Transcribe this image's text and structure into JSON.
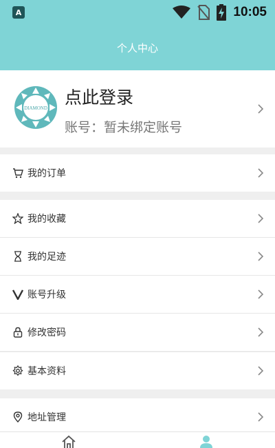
{
  "status_bar": {
    "app_badge": "A",
    "time": "10:05"
  },
  "header": {
    "title": "个人中心"
  },
  "profile": {
    "login_text": "点此登录",
    "account_text": "账号：暂未绑定账号",
    "avatar_logo_text": "DIAMOND"
  },
  "menu": {
    "orders": "我的订单",
    "favorites": "我的收藏",
    "history": "我的足迹",
    "upgrade": "账号升级",
    "password": "修改密码",
    "profile_info": "基本资料",
    "address": "地址管理"
  },
  "colors": {
    "accent": "#7fd4d6",
    "tab_active": "#7fd4d6"
  },
  "icons": {
    "orders": "cart-icon",
    "favorites": "star-icon",
    "history": "hourglass-icon",
    "upgrade": "v-icon",
    "password": "lock-icon",
    "profile_info": "gear-flower-icon",
    "address": "location-pin-icon",
    "tab_home": "home-icon",
    "tab_user": "user-icon"
  }
}
